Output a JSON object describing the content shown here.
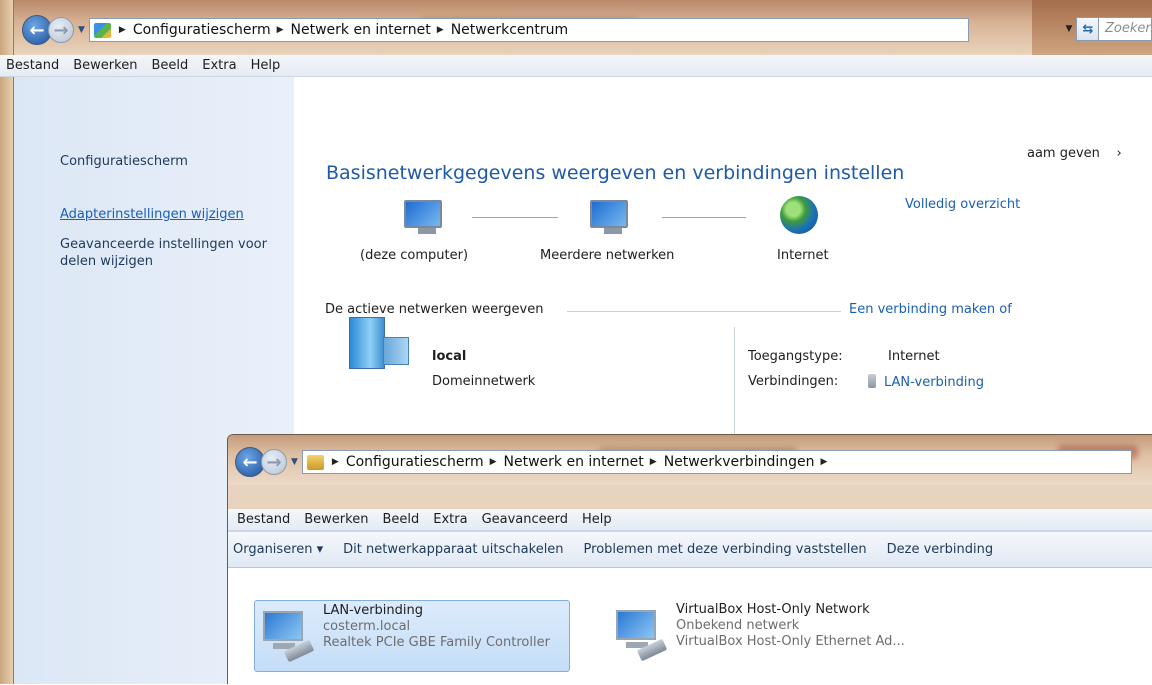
{
  "back_window": {
    "breadcrumb": [
      "Configuratiescherm",
      "Netwerk en internet",
      "Netwerkcentrum"
    ],
    "search_placeholder": "Zoeken",
    "menu": [
      "Bestand",
      "Bewerken",
      "Beeld",
      "Extra",
      "Help"
    ],
    "sidebar": {
      "home": "Configuratiescherm",
      "adapter_link": "Adapterinstellingen wijzigen",
      "sharing_link": "Geavanceerde instellingen voor delen wijzigen"
    },
    "heading": "Basisnetwerkgegevens weergeven en verbindingen instellen",
    "full_overview_link": "Volledig overzicht",
    "right_cut_text": "aam geven",
    "map": {
      "this_computer": "(deze computer)",
      "multiple_networks": "Meerdere netwerken",
      "internet": "Internet"
    },
    "active_networks_label": "De actieve netwerken weergeven",
    "new_connection_link": "Een verbinding maken of",
    "network": {
      "name": "local",
      "type": "Domeinnetwerk",
      "access_label": "Toegangstype:",
      "access_value": "Internet",
      "connections_label": "Verbindingen:",
      "connections_value": "LAN-verbinding"
    }
  },
  "front_window": {
    "breadcrumb": [
      "Configuratiescherm",
      "Netwerk en internet",
      "Netwerkverbindingen"
    ],
    "menu": [
      "Bestand",
      "Bewerken",
      "Beeld",
      "Extra",
      "Geavanceerd",
      "Help"
    ],
    "commands": [
      "Organiseren ▾",
      "Dit netwerkapparaat uitschakelen",
      "Problemen met deze verbinding vaststellen",
      "Deze verbinding"
    ],
    "adapters": [
      {
        "name": "LAN-verbinding",
        "network": "costerm.local",
        "device": "Realtek PCIe GBE Family Controller"
      },
      {
        "name": "VirtualBox Host-Only Network",
        "network": "Onbekend netwerk",
        "device": "VirtualBox Host-Only Ethernet Ad..."
      }
    ]
  }
}
